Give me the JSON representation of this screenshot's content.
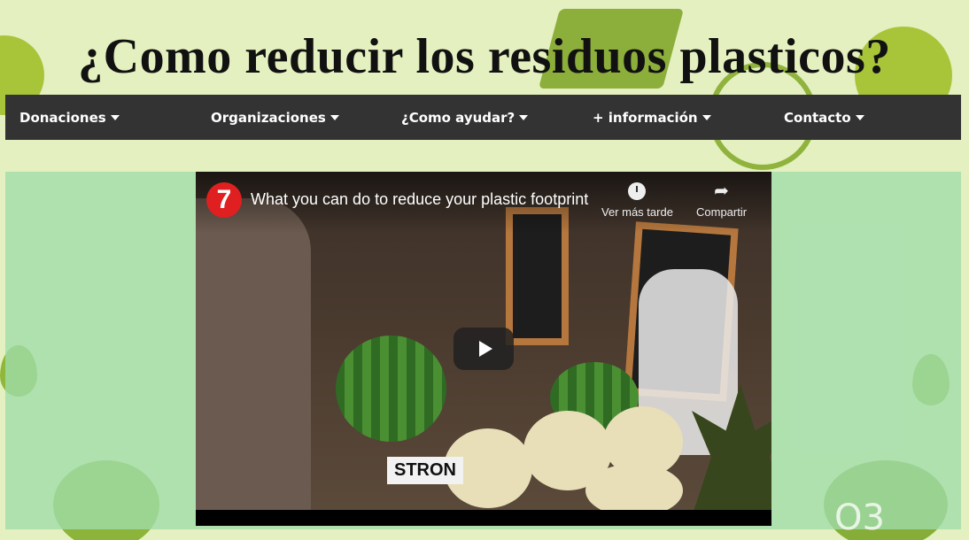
{
  "page": {
    "title": "¿Como reducir los residuos plasticos?"
  },
  "nav": {
    "items": [
      {
        "label": "Donaciones"
      },
      {
        "label": "Organizaciones"
      },
      {
        "label": "¿Como ayudar?"
      },
      {
        "label": "+ información"
      },
      {
        "label": "Contacto"
      }
    ]
  },
  "video": {
    "channel_logo": "7",
    "title": "What you can do to reduce your plastic footprint",
    "watch_later_label": "Ver más tarde",
    "share_label": "Compartir",
    "overlay_text": "STRON"
  },
  "decor": {
    "o3_label": "O3"
  },
  "colors": {
    "nav_bg": "#333333",
    "page_bg": "#e4f0bf",
    "panel_bg": "#a0dcaa"
  },
  "icons": [
    "chevron-down-icon",
    "clock-icon",
    "share-icon",
    "play-icon"
  ]
}
